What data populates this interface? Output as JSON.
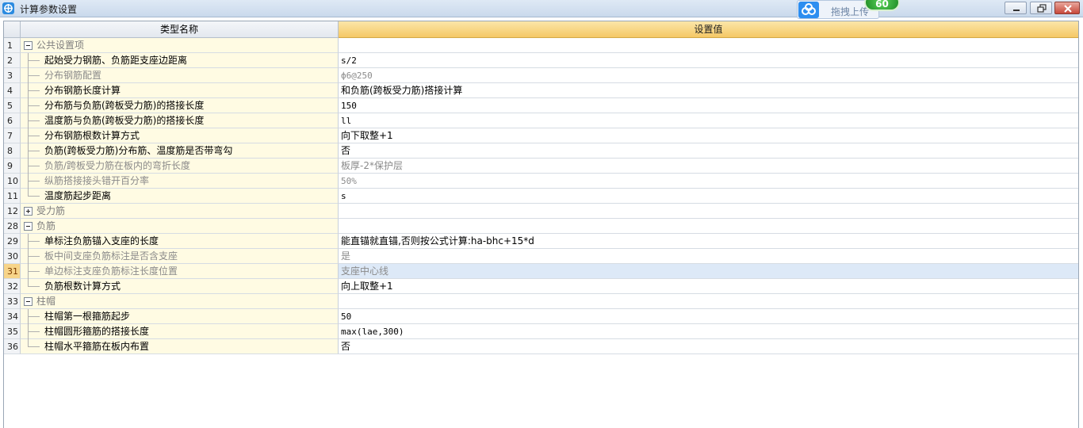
{
  "window": {
    "title": "计算参数设置"
  },
  "upload": {
    "label": "拖拽上传",
    "badge": "60",
    "icon": "cloud-upload-icon"
  },
  "grid": {
    "headers": {
      "name": "类型名称",
      "value": "设置值"
    },
    "rows": [
      {
        "num": "1",
        "kind": "group",
        "expanded": true,
        "name": "公共设置项",
        "value": ""
      },
      {
        "num": "2",
        "kind": "item",
        "name": "起始受力钢筋、负筋距支座边距离",
        "value": "s/2",
        "mono": true
      },
      {
        "num": "3",
        "kind": "item",
        "disabled": true,
        "name": "分布钢筋配置",
        "value": "ф6@250",
        "mono": true
      },
      {
        "num": "4",
        "kind": "item",
        "name": "分布钢筋长度计算",
        "value": "和负筋(跨板受力筋)搭接计算"
      },
      {
        "num": "5",
        "kind": "item",
        "name": "分布筋与负筋(跨板受力筋)的搭接长度",
        "value": "150",
        "mono": true
      },
      {
        "num": "6",
        "kind": "item",
        "name": "温度筋与负筋(跨板受力筋)的搭接长度",
        "value": "ll",
        "mono": true
      },
      {
        "num": "7",
        "kind": "item",
        "name": "分布钢筋根数计算方式",
        "value": "向下取整+1"
      },
      {
        "num": "8",
        "kind": "item",
        "name": "负筋(跨板受力筋)分布筋、温度筋是否带弯勾",
        "value": "否"
      },
      {
        "num": "9",
        "kind": "item",
        "disabled": true,
        "name": "负筋/跨板受力筋在板内的弯折长度",
        "value": "板厚-2*保护层"
      },
      {
        "num": "10",
        "kind": "item",
        "disabled": true,
        "name": "纵筋搭接接头错开百分率",
        "value": "50%",
        "mono": true
      },
      {
        "num": "11",
        "kind": "item",
        "last": true,
        "name": "温度筋起步距离",
        "value": "s",
        "mono": true
      },
      {
        "num": "12",
        "kind": "group",
        "expanded": false,
        "name": "受力筋",
        "value": ""
      },
      {
        "num": "28",
        "kind": "group",
        "expanded": true,
        "name": "负筋",
        "value": ""
      },
      {
        "num": "29",
        "kind": "item",
        "name": "单标注负筋锚入支座的长度",
        "value": "能直锚就直锚,否则按公式计算:ha-bhc+15*d"
      },
      {
        "num": "30",
        "kind": "item",
        "disabled": true,
        "name": "板中间支座负筋标注是否含支座",
        "value": "是"
      },
      {
        "num": "31",
        "kind": "item",
        "disabled": true,
        "selected": true,
        "name": "单边标注支座负筋标注长度位置",
        "value": "支座中心线"
      },
      {
        "num": "32",
        "kind": "item",
        "last": true,
        "name": "负筋根数计算方式",
        "value": "向上取整+1"
      },
      {
        "num": "33",
        "kind": "group",
        "expanded": true,
        "name": "柱帽",
        "value": ""
      },
      {
        "num": "34",
        "kind": "item",
        "name": "柱帽第一根箍筋起步",
        "value": "50",
        "mono": true
      },
      {
        "num": "35",
        "kind": "item",
        "name": "柱帽圆形箍筋的搭接长度",
        "value": "max(lae,300)",
        "mono": true
      },
      {
        "num": "36",
        "kind": "item",
        "last": true,
        "name": "柱帽水平箍筋在板内布置",
        "value": "否"
      }
    ]
  }
}
